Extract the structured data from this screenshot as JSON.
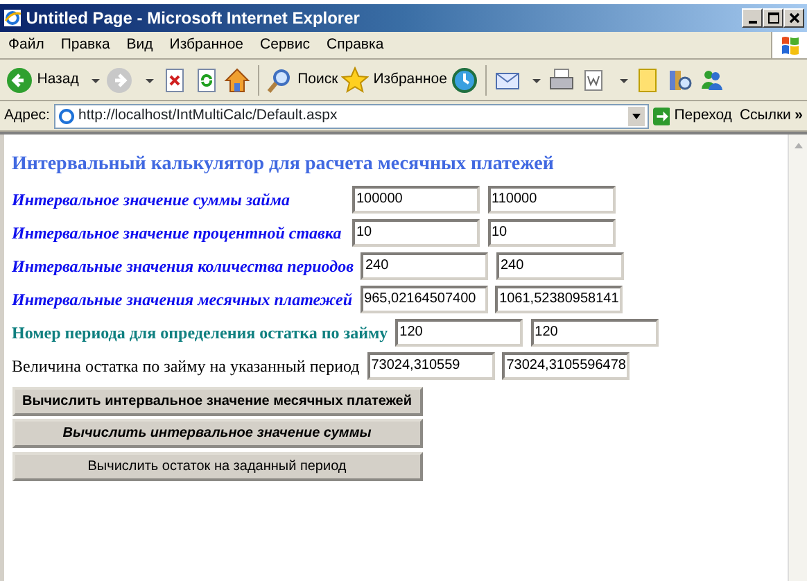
{
  "window": {
    "title": "Untitled Page - Microsoft Internet Explorer"
  },
  "menu": [
    "Файл",
    "Правка",
    "Вид",
    "Избранное",
    "Сервис",
    "Справка"
  ],
  "toolbar": {
    "back": "Назад",
    "search": "Поиск",
    "favorites": "Избранное"
  },
  "address": {
    "label": "Адрес:",
    "url": "http://localhost/IntMultiCalc/Default.aspx",
    "go": "Переход",
    "links": "Ссылки",
    "more": "»"
  },
  "form": {
    "heading": "Интервальный калькулятор для расчета месячных платежей",
    "rows": [
      {
        "kind": "input",
        "label": "Интервальное значение суммы займа",
        "values": [
          "100000",
          "110000"
        ]
      },
      {
        "kind": "input",
        "label": "Интервальное значение процентной ставка",
        "values": [
          "10",
          "10"
        ]
      },
      {
        "kind": "input",
        "label": "Интервальные значения количества периодов",
        "values": [
          "240",
          "240"
        ]
      },
      {
        "kind": "input",
        "label": "Интервальные значения месячных платежей",
        "values": [
          "965,02164507400",
          "1061,52380958141"
        ]
      },
      {
        "kind": "period",
        "label": "Номер периода для определения остатка по займу",
        "values": [
          "120",
          "120"
        ]
      },
      {
        "kind": "result",
        "label": "Величина остатка по займу на указанный период",
        "values": [
          "73024,310559",
          "73024,3105596478"
        ]
      }
    ],
    "buttons": [
      {
        "label": "Вычислить интервальное значение месячных платежей"
      },
      {
        "label": "Вычислить интервальное значение суммы"
      },
      {
        "label": "Вычислить остаток на заданный период"
      }
    ]
  }
}
